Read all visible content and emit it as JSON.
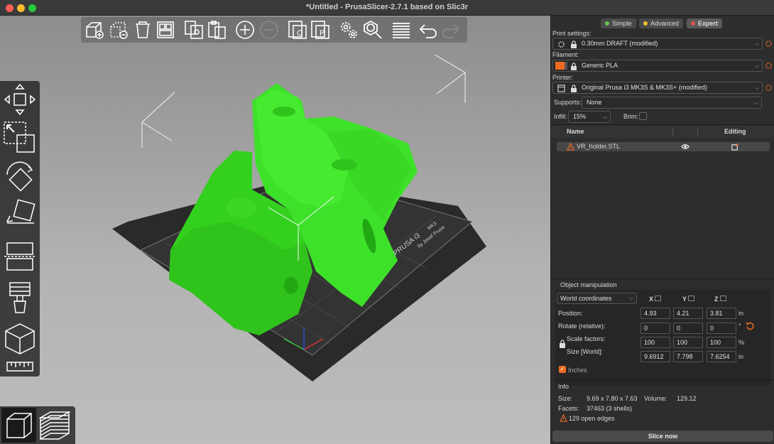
{
  "window": {
    "title": "*Untitled - PrusaSlicer-2.7.1 based on Slic3r"
  },
  "modes": {
    "simple": "Simple",
    "advanced": "Advanced",
    "expert": "Expert"
  },
  "colors": {
    "simple": "#6cc24a",
    "advanced": "#f0c030",
    "expert": "#e05050",
    "model": "#3ee12a",
    "filament": "#ed6b21",
    "accent": "#ed6b21"
  },
  "settings": {
    "print_label": "Print settings:",
    "print_value": "0.30mm DRAFT (modified)",
    "filament_label": "Filament:",
    "filament_value": "Generic PLA",
    "printer_label": "Printer:",
    "printer_value": "Original Prusa i3 MK3S & MK3S+ (modified)",
    "supports_label": "Supports:",
    "supports_value": "None",
    "infill_label": "Infill:",
    "infill_value": "15%",
    "brim_label": "Brim:"
  },
  "object_list": {
    "col_name": "Name",
    "col_editing": "Editing",
    "items": [
      {
        "name": "VR_holder.STL"
      }
    ]
  },
  "manipulation": {
    "title": "Object manipulation",
    "coords": "World coordinates",
    "x": "X",
    "y": "Y",
    "z": "Z",
    "position_label": "Position:",
    "position": [
      "4.93",
      "4.21",
      "3.81"
    ],
    "position_unit": "in",
    "rotate_label": "Rotate (relative):",
    "rotate": [
      "0",
      "0",
      "0"
    ],
    "rotate_unit": "°",
    "scale_label": "Scale factors:",
    "scale": [
      "100",
      "100",
      "100"
    ],
    "scale_unit": "%",
    "size_label": "Size [World]:",
    "size": [
      "9.6912",
      "7.798",
      "7.6254"
    ],
    "size_unit": "in",
    "inches_label": "Inches"
  },
  "info": {
    "title": "Info",
    "size_label": "Size:",
    "size_value": "9.69 x 7.80 x 7.63",
    "volume_label": "Volume:",
    "volume_value": "129.12",
    "facets_label": "Facets:",
    "facets_value": "37463 (3 shells)",
    "warning": "129 open edges"
  },
  "bed": {
    "brand": "PRUSA i3",
    "model": "MK3",
    "by": "by Josef Prusa"
  },
  "slice_button": "Slice now"
}
